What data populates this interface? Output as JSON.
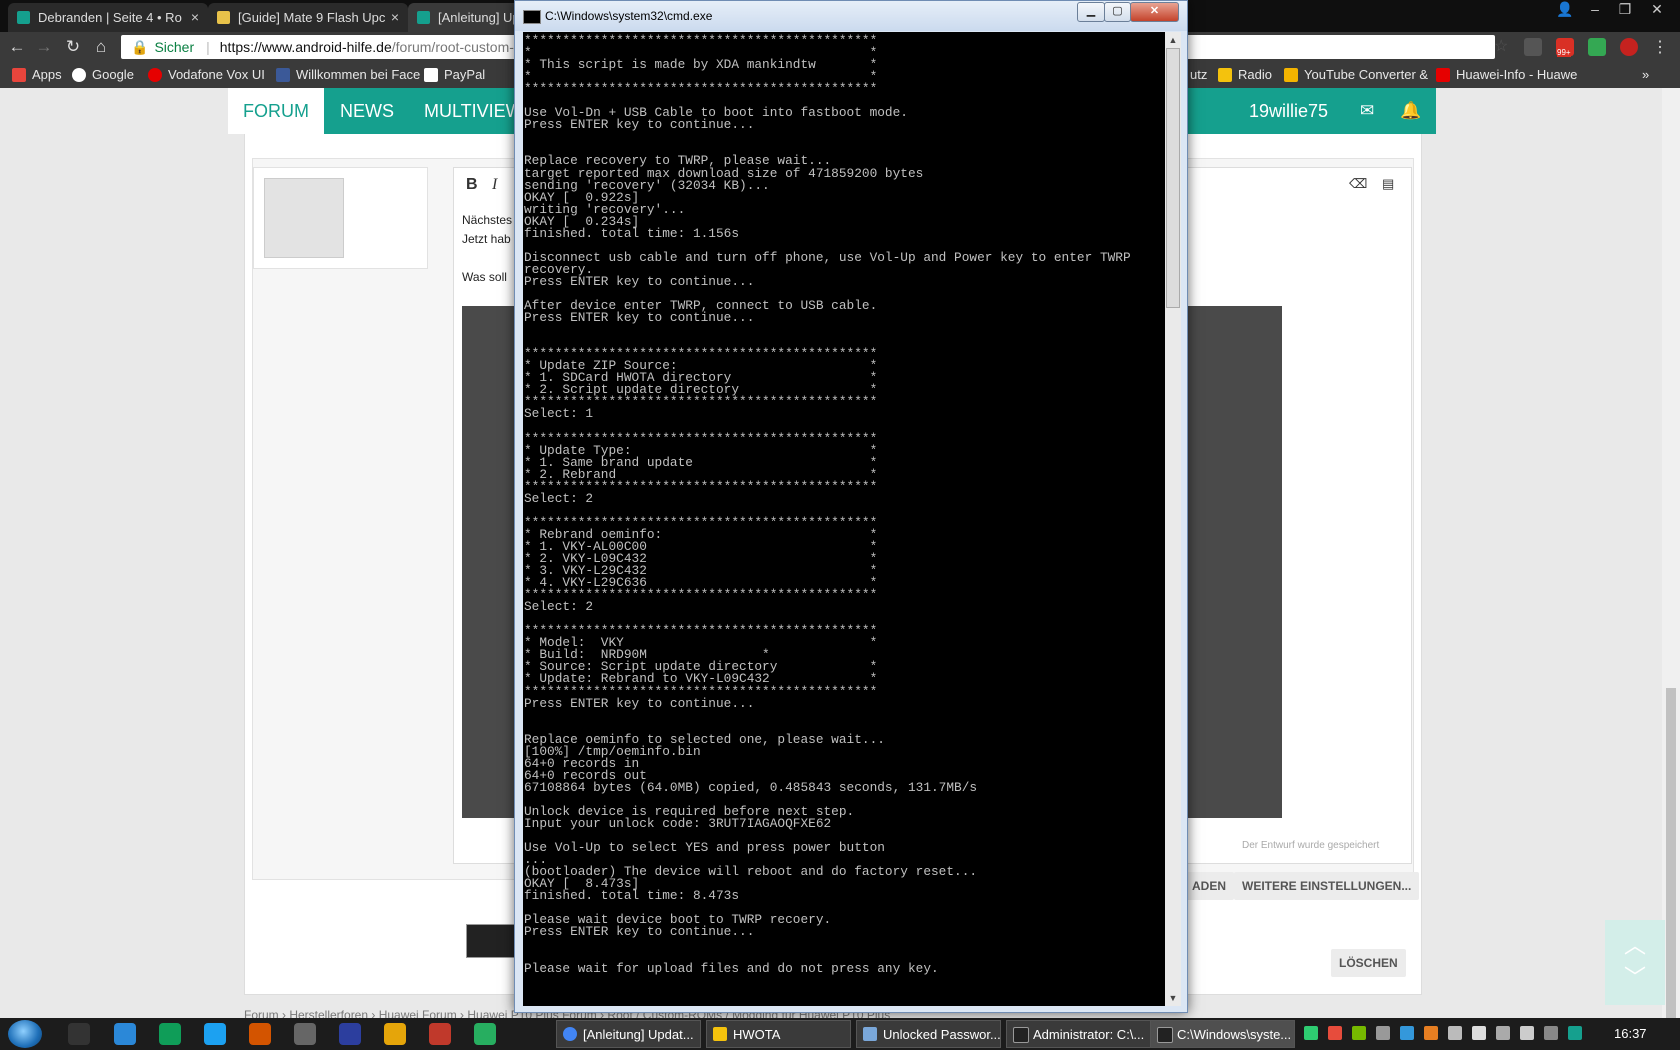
{
  "browser": {
    "tabs": [
      {
        "label": "Debranden | Seite 4 • Ro",
        "color": "#15a08e"
      },
      {
        "label": "[Guide] Mate 9 Flash Upc",
        "color": "#e8c24a"
      },
      {
        "label": "[Anleitung] Upd",
        "color": "#15a08e"
      }
    ],
    "secure_label": "Sicher",
    "url_host": "https://www.android-hilfe.de",
    "url_path": "/forum/root-custom-",
    "badge": "99+"
  },
  "bookmarks": [
    {
      "label": "Apps",
      "color": "#e8453c"
    },
    {
      "label": "Google",
      "color": "#ffffff"
    },
    {
      "label": "Vodafone Vox UI",
      "color": "#e60000"
    },
    {
      "label": "Willkommen bei Face",
      "color": "#3b5998"
    },
    {
      "label": "PayPal",
      "color": "#ffffff"
    },
    {
      "label": "utz",
      "color": "#3a3a3a"
    },
    {
      "label": "Radio",
      "color": "#f4c20d"
    },
    {
      "label": "YouTube Converter &",
      "color": "#f4b400"
    },
    {
      "label": "Huawei-Info - Huawe",
      "color": "#e60000"
    }
  ],
  "forum": {
    "nav": [
      "FORUM",
      "NEWS",
      "MULTIVIEW"
    ],
    "username": "19willie75",
    "editor_lines": [
      "Nächstes",
      "Jetzt hab",
      "Was soll"
    ],
    "draft_saved": "Der Entwurf wurde gespeichert",
    "buttons": {
      "upload": "ADEN",
      "more_settings": "WEITERE EINSTELLUNGEN...",
      "delete": "LÖSCHEN"
    },
    "breadcrumb": "Forum  ›  Herstellerforen  ›  Huawei Forum  ›  Huawei P10 Plus Forum  ›  Root / Custom-ROMs / Modding für Huawei P10 Plus"
  },
  "cmd": {
    "title": "C:\\Windows\\system32\\cmd.exe",
    "lines": [
      "**********************************************",
      "*                                            *",
      "* This script is made by XDA mankindtw       *",
      "*                                            *",
      "**********************************************",
      "",
      "Use Vol-Dn + USB Cable to boot into fastboot mode.",
      "Press ENTER key to continue...",
      "",
      "",
      "Replace recovery to TWRP, please wait...",
      "target reported max download size of 471859200 bytes",
      "sending 'recovery' (32034 KB)...",
      "OKAY [  0.922s]",
      "writing 'recovery'...",
      "OKAY [  0.234s]",
      "finished. total time: 1.156s",
      "",
      "Disconnect usb cable and turn off phone, use Vol-Up and Power key to enter TWRP",
      "recovery.",
      "Press ENTER key to continue...",
      "",
      "After device enter TWRP, connect to USB cable.",
      "Press ENTER key to continue...",
      "",
      "",
      "**********************************************",
      "* Update ZIP Source:                         *",
      "* 1. SDCard HWOTA directory                  *",
      "* 2. Script update directory                 *",
      "**********************************************",
      "Select: 1",
      "",
      "**********************************************",
      "* Update Type:                               *",
      "* 1. Same brand update                       *",
      "* 2. Rebrand                                 *",
      "**********************************************",
      "Select: 2",
      "",
      "**********************************************",
      "* Rebrand oeminfo:                           *",
      "* 1. VKY-AL00C00                             *",
      "* 2. VKY-L09C432                             *",
      "* 3. VKY-L29C432                             *",
      "* 4. VKY-L29C636                             *",
      "**********************************************",
      "Select: 2",
      "",
      "**********************************************",
      "* Model:  VKY                                *",
      "* Build:  NRD90M               *",
      "* Source: Script update directory            *",
      "* Update: Rebrand to VKY-L09C432             *",
      "**********************************************",
      "Press ENTER key to continue...",
      "",
      "",
      "Replace oeminfo to selected one, please wait...",
      "[100%] /tmp/oeminfo.bin",
      "64+0 records in",
      "64+0 records out",
      "67108864 bytes (64.0MB) copied, 0.485843 seconds, 131.7MB/s",
      "",
      "Unlock device is required before next step.",
      "Input your unlock code: 3RUT7IAGAOQFXE62",
      "",
      "Use Vol-Up to select YES and press power button",
      "...",
      "(bootloader) The device will reboot and do factory reset...",
      "OKAY [  8.473s]",
      "finished. total time: 8.473s",
      "",
      "Please wait device boot to TWRP recoery.",
      "Press ENTER key to continue...",
      "",
      "",
      "Please wait for upload files and do not press any key."
    ]
  },
  "taskbar": {
    "tasks": [
      {
        "label": "[Anleitung] Updat...",
        "color": "#4285f4"
      },
      {
        "label": "HWOTA",
        "color": "#f4c20d"
      },
      {
        "label": "Unlocked Passwor...",
        "color": "#7aa7d9"
      },
      {
        "label": "Administrator: C:\\...",
        "color": "#222222"
      },
      {
        "label": "C:\\Windows\\syste...",
        "color": "#222222"
      }
    ],
    "time": "16:37"
  }
}
